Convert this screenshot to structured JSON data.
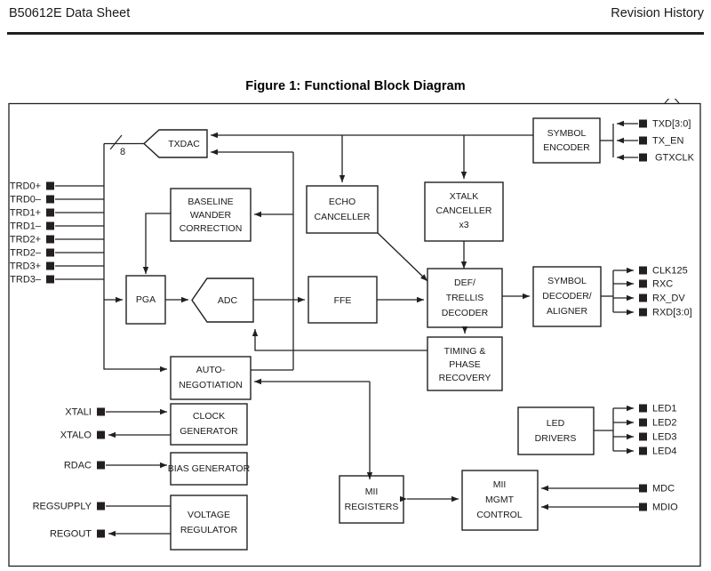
{
  "header": {
    "left_title": "B50612E Data Sheet",
    "right_title": "Revision History"
  },
  "figure": {
    "caption": "Figure 1:  Functional Block Diagram"
  },
  "diagram": {
    "bus_width_label": "8",
    "blocks": {
      "txdac": "TXDAC",
      "baseline_wander_l1": "BASELINE",
      "baseline_wander_l2": "WANDER",
      "baseline_wander_l3": "CORRECTION",
      "echo_canceller_l1": "ECHO",
      "echo_canceller_l2": "CANCELLER",
      "xtalk_canceller_l1": "XTALK",
      "xtalk_canceller_l2": "CANCELLER",
      "xtalk_canceller_l3": "x3",
      "symbol_encoder_l1": "SYMBOL",
      "symbol_encoder_l2": "ENCODER",
      "pga": "PGA",
      "adc": "ADC",
      "ffe": "FFE",
      "def_trellis_l1": "DEF/",
      "def_trellis_l2": "TRELLIS",
      "def_trellis_l3": "DECODER",
      "symbol_decoder_l1": "SYMBOL",
      "symbol_decoder_l2": "DECODER/",
      "symbol_decoder_l3": "ALIGNER",
      "timing_phase_l1": "TIMING &",
      "timing_phase_l2": "PHASE",
      "timing_phase_l3": "RECOVERY",
      "auto_neg_l1": "AUTO-",
      "auto_neg_l2": "NEGOTIATION",
      "clock_gen_l1": "CLOCK",
      "clock_gen_l2": "GENERATOR",
      "bias_gen": "BIAS GENERATOR",
      "voltage_reg_l1": "VOLTAGE",
      "voltage_reg_l2": "REGULATOR",
      "mii_registers_l1": "MII",
      "mii_registers_l2": "REGISTERS",
      "mii_mgmt_l1": "MII",
      "mii_mgmt_l2": "MGMT",
      "mii_mgmt_l3": "CONTROL",
      "led_drivers_l1": "LED",
      "led_drivers_l2": "DRIVERS"
    },
    "pins_left_twisted_pair": [
      {
        "label": "TRD0+"
      },
      {
        "label": "TRD0–"
      },
      {
        "label": "TRD1+"
      },
      {
        "label": "TRD1–"
      },
      {
        "label": "TRD2+"
      },
      {
        "label": "TRD2–"
      },
      {
        "label": "TRD3+"
      },
      {
        "label": "TRD3–"
      }
    ],
    "pins_left_misc": [
      {
        "label": "XTALI",
        "direction": "in"
      },
      {
        "label": "XTALO",
        "direction": "out"
      },
      {
        "label": "RDAC",
        "direction": "in"
      },
      {
        "label": "REGSUPPLY",
        "direction": "in"
      },
      {
        "label": "REGOUT",
        "direction": "out"
      }
    ],
    "pins_right_tx": [
      {
        "label": "TXD[3:0]",
        "direction": "in"
      },
      {
        "label": "TX_EN",
        "direction": "in"
      },
      {
        "label": "GTXCLK",
        "direction": "in"
      }
    ],
    "pins_right_rx": [
      {
        "label": "CLK125",
        "direction": "out"
      },
      {
        "label": "RXC",
        "direction": "out"
      },
      {
        "label": "RX_DV",
        "direction": "out"
      },
      {
        "label": "RXD[3:0]",
        "direction": "out"
      }
    ],
    "pins_right_led": [
      {
        "label": "LED1",
        "direction": "out"
      },
      {
        "label": "LED2",
        "direction": "out"
      },
      {
        "label": "LED3",
        "direction": "out"
      },
      {
        "label": "LED4",
        "direction": "out"
      }
    ],
    "pins_right_mgmt": [
      {
        "label": "MDC",
        "direction": "in"
      },
      {
        "label": "MDIO",
        "direction": "bidir"
      }
    ]
  },
  "colors": {
    "ink": "#231f20",
    "text": "#1a1a1a",
    "background": "#ffffff"
  }
}
